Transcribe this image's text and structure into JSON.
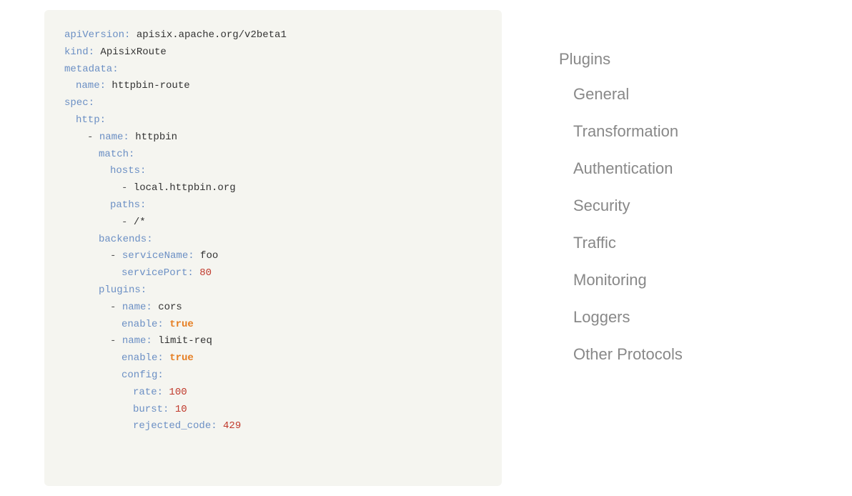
{
  "code": {
    "lines": [
      {
        "indent": 0,
        "parts": [
          {
            "type": "key",
            "text": "apiVersion:"
          },
          {
            "type": "value-str",
            "text": " apisix.apache.org/v2beta1"
          }
        ]
      },
      {
        "indent": 0,
        "parts": [
          {
            "type": "key",
            "text": "kind:"
          },
          {
            "type": "value-str",
            "text": " ApisixRoute"
          }
        ]
      },
      {
        "indent": 0,
        "parts": [
          {
            "type": "key",
            "text": "metadata:"
          }
        ]
      },
      {
        "indent": 1,
        "parts": [
          {
            "type": "key",
            "text": "name:"
          },
          {
            "type": "value-str",
            "text": " httpbin-route"
          }
        ]
      },
      {
        "indent": 0,
        "parts": [
          {
            "type": "key",
            "text": "spec:"
          }
        ]
      },
      {
        "indent": 1,
        "parts": [
          {
            "type": "key",
            "text": "http:"
          }
        ]
      },
      {
        "indent": 2,
        "parts": [
          {
            "type": "dash",
            "text": "- "
          },
          {
            "type": "key",
            "text": "name:"
          },
          {
            "type": "value-str",
            "text": " httpbin"
          }
        ]
      },
      {
        "indent": 3,
        "parts": [
          {
            "type": "key",
            "text": "match:"
          }
        ]
      },
      {
        "indent": 4,
        "parts": [
          {
            "type": "key",
            "text": "hosts:"
          }
        ]
      },
      {
        "indent": 5,
        "parts": [
          {
            "type": "dash",
            "text": "- "
          },
          {
            "type": "value-str",
            "text": "local.httpbin.org"
          }
        ]
      },
      {
        "indent": 4,
        "parts": [
          {
            "type": "key",
            "text": "paths:"
          }
        ]
      },
      {
        "indent": 5,
        "parts": [
          {
            "type": "dash",
            "text": "- "
          },
          {
            "type": "value-str",
            "text": "/*"
          }
        ]
      },
      {
        "indent": 3,
        "parts": [
          {
            "type": "key",
            "text": "backends:"
          }
        ]
      },
      {
        "indent": 4,
        "parts": [
          {
            "type": "dash",
            "text": "- "
          },
          {
            "type": "key",
            "text": "serviceName:"
          },
          {
            "type": "value-str",
            "text": " foo"
          }
        ]
      },
      {
        "indent": 5,
        "parts": [
          {
            "type": "key",
            "text": "servicePort:"
          },
          {
            "type": "value-num",
            "text": " 80"
          }
        ]
      },
      {
        "indent": 3,
        "parts": [
          {
            "type": "key",
            "text": "plugins:"
          }
        ]
      },
      {
        "indent": 4,
        "parts": [
          {
            "type": "dash",
            "text": "- "
          },
          {
            "type": "key",
            "text": "name:"
          },
          {
            "type": "value-str",
            "text": " cors"
          }
        ]
      },
      {
        "indent": 5,
        "parts": [
          {
            "type": "key",
            "text": "enable:"
          },
          {
            "type": "value-bool",
            "text": " true"
          }
        ]
      },
      {
        "indent": 4,
        "parts": [
          {
            "type": "dash",
            "text": "- "
          },
          {
            "type": "key",
            "text": "name:"
          },
          {
            "type": "value-str",
            "text": " limit-req"
          }
        ]
      },
      {
        "indent": 5,
        "parts": [
          {
            "type": "key",
            "text": "enable:"
          },
          {
            "type": "value-bool",
            "text": " true"
          }
        ]
      },
      {
        "indent": 5,
        "parts": [
          {
            "type": "key",
            "text": "config:"
          }
        ]
      },
      {
        "indent": 6,
        "parts": [
          {
            "type": "key",
            "text": "rate:"
          },
          {
            "type": "value-num",
            "text": " 100"
          }
        ]
      },
      {
        "indent": 6,
        "parts": [
          {
            "type": "key",
            "text": "burst:"
          },
          {
            "type": "value-num",
            "text": " 10"
          }
        ]
      },
      {
        "indent": 6,
        "parts": [
          {
            "type": "key",
            "text": "rejected_code:"
          },
          {
            "type": "value-num",
            "text": " 429"
          }
        ]
      }
    ]
  },
  "nav": {
    "section_label": "Plugins",
    "items": [
      {
        "label": "General"
      },
      {
        "label": "Transformation"
      },
      {
        "label": "Authentication"
      },
      {
        "label": "Security"
      },
      {
        "label": "Traffic"
      },
      {
        "label": "Monitoring"
      },
      {
        "label": "Loggers"
      },
      {
        "label": "Other Protocols"
      }
    ]
  }
}
